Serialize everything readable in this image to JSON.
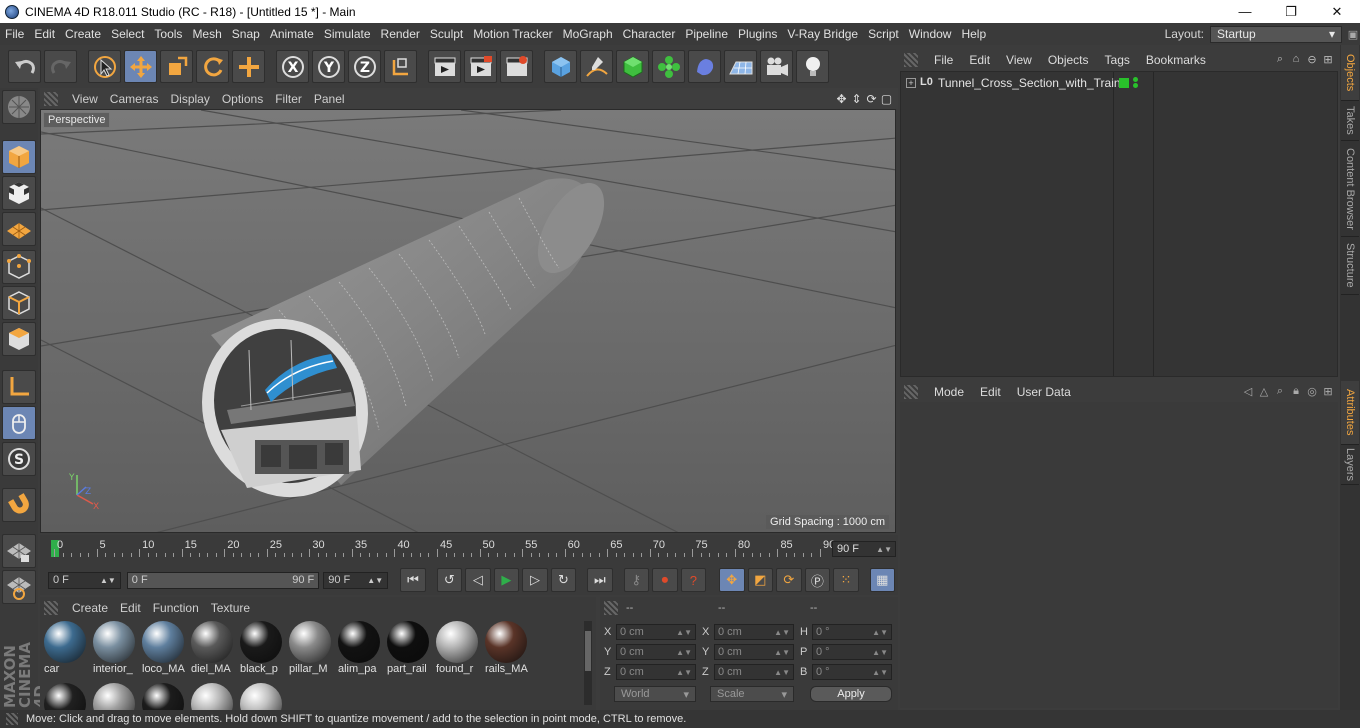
{
  "window": {
    "title": "CINEMA 4D R18.011 Studio (RC - R18) - [Untitled 15 *] - Main",
    "minimize_label": "—",
    "maximize_label": "❐",
    "close_label": "✕"
  },
  "menubar": {
    "items": [
      "File",
      "Edit",
      "Create",
      "Select",
      "Tools",
      "Mesh",
      "Snap",
      "Animate",
      "Simulate",
      "Render",
      "Sculpt",
      "Motion Tracker",
      "MoGraph",
      "Character",
      "Pipeline",
      "Plugins",
      "V-Ray Bridge",
      "Script",
      "Window",
      "Help"
    ],
    "layout_label": "Layout:",
    "layout_value": "Startup"
  },
  "viewport": {
    "menu": [
      "View",
      "Cameras",
      "Display",
      "Options",
      "Filter",
      "Panel"
    ],
    "camera_label": "Perspective",
    "grid_spacing": "Grid Spacing : 1000 cm",
    "axis_labels": {
      "x": "X",
      "y": "Y",
      "z": "Z"
    },
    "nav_icons": [
      "move-view-icon",
      "zoom-view-icon",
      "rotate-view-icon",
      "maximize-view-icon"
    ]
  },
  "timeline": {
    "ticks": [
      "0",
      "5",
      "10",
      "15",
      "20",
      "25",
      "30",
      "35",
      "40",
      "45",
      "50",
      "55",
      "60",
      "65",
      "70",
      "75",
      "80",
      "85",
      "90"
    ],
    "current_frame": "90 F",
    "start_field": "0 F",
    "range_start": "0 F",
    "range_end": "90 F",
    "end_field": "90 F"
  },
  "materials": {
    "menu": [
      "Create",
      "Edit",
      "Function",
      "Texture"
    ],
    "items": [
      {
        "label": "car",
        "color": "#3d6b8f"
      },
      {
        "label": "interior_",
        "color": "#7a8fa0"
      },
      {
        "label": "loco_MA",
        "color": "#5f7f9e"
      },
      {
        "label": "diel_MA",
        "color": "#5a5a5a"
      },
      {
        "label": "black_p",
        "color": "#1a1a1a"
      },
      {
        "label": "pillar_M",
        "color": "#8a8a8a"
      },
      {
        "label": "alim_pa",
        "color": "#121212"
      },
      {
        "label": "part_rail",
        "color": "#0e0e0e"
      },
      {
        "label": "found_r",
        "color": "#b4b4b4"
      },
      {
        "label": "rails_MA",
        "color": "#5a3428"
      }
    ],
    "row2": [
      {
        "color": "#202020"
      },
      {
        "color": "#a0a0a0"
      },
      {
        "color": "#1c1c1c"
      },
      {
        "color": "#b8b8b8"
      },
      {
        "color": "#c0c0c0"
      }
    ]
  },
  "coordinates": {
    "headers": [
      "--",
      "--",
      "--"
    ],
    "rows": [
      {
        "a": "X",
        "av": "0 cm",
        "b": "X",
        "bv": "0 cm",
        "c": "H",
        "cv": "0 °"
      },
      {
        "a": "Y",
        "av": "0 cm",
        "b": "Y",
        "bv": "0 cm",
        "c": "P",
        "cv": "0 °"
      },
      {
        "a": "Z",
        "av": "0 cm",
        "b": "Z",
        "bv": "0 cm",
        "c": "B",
        "cv": "0 °"
      }
    ],
    "world_select": "World",
    "scale_select": "Scale",
    "apply_label": "Apply"
  },
  "objects": {
    "menu": [
      "File",
      "Edit",
      "View",
      "Objects",
      "Tags",
      "Bookmarks"
    ],
    "items": [
      {
        "name": "Tunnel_Cross_Section_with_Train",
        "icon_label": "L0"
      }
    ],
    "expand_label": "+"
  },
  "attributes": {
    "menu": [
      "Mode",
      "Edit",
      "User Data"
    ]
  },
  "right_tabs": {
    "tabs": [
      "Objects",
      "Takes",
      "Content Browser",
      "Structure",
      "Attributes",
      "Layers"
    ]
  },
  "status": {
    "text": "Move: Click and drag to move elements. Hold down SHIFT to quantize movement / add to the selection in point mode, CTRL to remove."
  },
  "colors": {
    "accent_active": "#6c86b4",
    "orange_icon": "#f2a640",
    "green_play": "#2fae4a",
    "visible_green": "#29c12b"
  }
}
